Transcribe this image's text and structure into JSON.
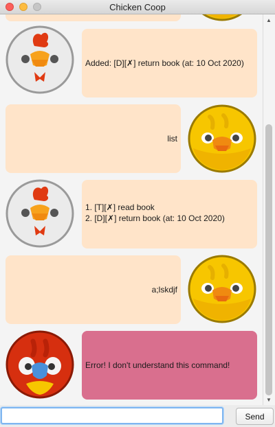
{
  "window": {
    "title": "Chicken Coop"
  },
  "messages": [
    {
      "sender": "bot",
      "text": "Added: [D][✗] return book (at: 10 Oct 2020)"
    },
    {
      "sender": "user",
      "text": "list"
    },
    {
      "sender": "bot",
      "text": "1. [T][✗] read book\n2. [D][✗] return book (at: 10 Oct 2020)"
    },
    {
      "sender": "user",
      "text": "a;lskdjf"
    },
    {
      "sender": "bot",
      "text": "Error! I don't understand this command!",
      "error": true
    }
  ],
  "input": {
    "value": "",
    "placeholder": ""
  },
  "send_label": "Send",
  "colors": {
    "bubble": "#ffe4c9",
    "error_bubble": "#d96f8e",
    "chicken_avatar": "#e8e8e8",
    "duck_avatar": "#f7c600",
    "parrot_avatar": "#d62f0f"
  },
  "icons": {
    "bot_avatar": "chicken-avatar-icon",
    "user_avatar": "duck-avatar-icon",
    "error_avatar": "parrot-avatar-icon"
  }
}
